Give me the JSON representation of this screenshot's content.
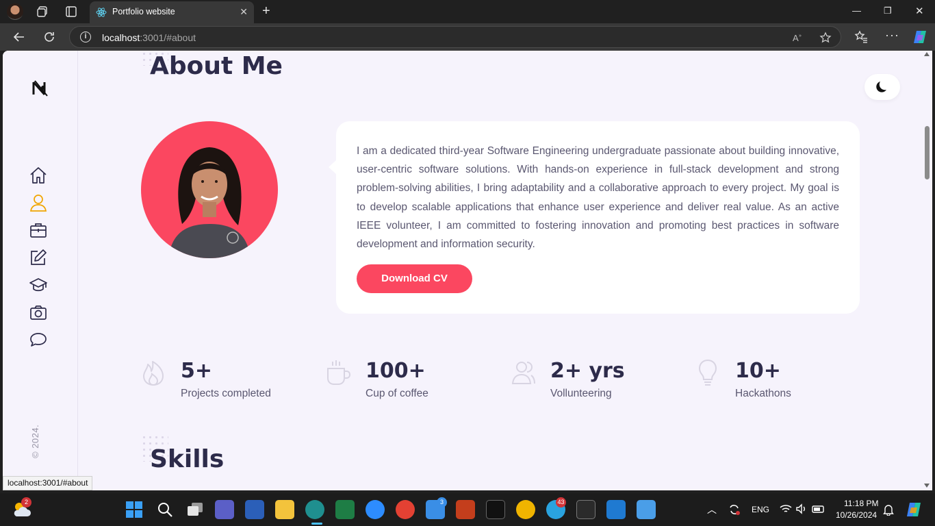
{
  "browser": {
    "tab_title": "Portfolio website",
    "url_host": "localhost",
    "url_rest": ":3001/#about",
    "status_url": "localhost:3001/#about"
  },
  "page": {
    "about_title": "About Me",
    "bio": "I am a dedicated third-year Software Engineering undergraduate passionate about building innovative, user-centric software solutions. With hands-on experience in full-stack development and strong problem-solving abilities, I bring adaptability and a collaborative approach to every project. My goal is to develop scalable applications that enhance user experience and deliver real value. As an active IEEE volunteer, I am committed to fostering innovation and promoting best practices in software development and information security.",
    "cv_button": "Download CV",
    "copyright": "© 2024.",
    "skills_title": "Skills",
    "stats": [
      {
        "value": "5+",
        "label": "Projects completed",
        "icon": "flame-icon"
      },
      {
        "value": "100+",
        "label": "Cup of coffee",
        "icon": "coffee-cup-icon"
      },
      {
        "value": "2+ yrs",
        "label": "Vollunteering",
        "icon": "users-icon"
      },
      {
        "value": "10+",
        "label": "Hackathons",
        "icon": "lightbulb-icon"
      }
    ],
    "sidebar_items": [
      "home-icon",
      "user-icon",
      "briefcase-icon",
      "edit-icon",
      "graduation-cap-icon",
      "camera-icon",
      "chat-icon"
    ],
    "accent_color": "#fb4760",
    "heading_color": "#2d2b4a"
  },
  "taskbar": {
    "weather_badge": "2",
    "mail_badge": "3",
    "telegram_badge": "43",
    "language": "ENG",
    "time": "11:18 PM",
    "date": "10/26/2024"
  }
}
